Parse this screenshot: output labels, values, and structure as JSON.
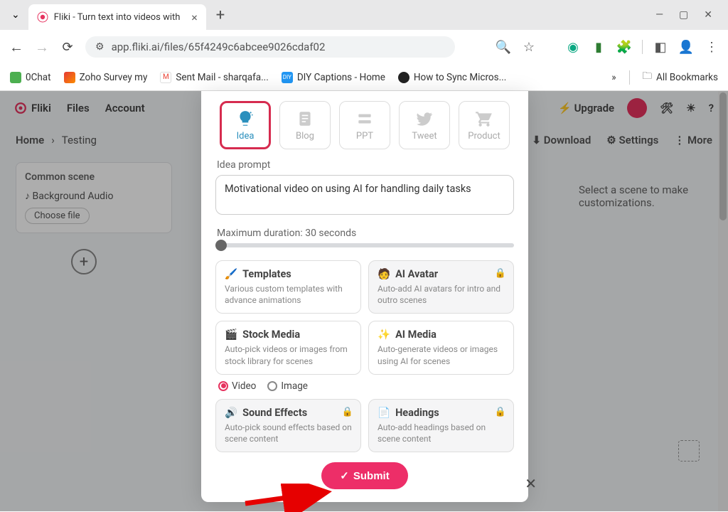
{
  "browser": {
    "tab_title": "Fliki - Turn text into videos with",
    "url": "app.fliki.ai/files/65f4249c6abcee9026cdaf02",
    "bookmarks": [
      {
        "label": "0Chat",
        "color": "#4caf50"
      },
      {
        "label": "Zoho Survey my",
        "color": "#d94b3c"
      },
      {
        "label": "Sent Mail - sharqafa...",
        "color": "#ea4335"
      },
      {
        "label": "DIY Captions - Home",
        "color": "#2196f3"
      },
      {
        "label": "How to Sync Micros...",
        "color": "#222"
      }
    ],
    "all_bookmarks": "All Bookmarks"
  },
  "app": {
    "brand": "Fliki",
    "nav": {
      "files": "Files",
      "account": "Account"
    },
    "header_right": {
      "upgrade": "Upgrade"
    },
    "breadcrumbs": {
      "home": "Home",
      "sep": "›",
      "current": "Testing"
    },
    "toolbar": {
      "download": "Download",
      "settings": "Settings",
      "more": "More"
    },
    "left_panel": {
      "title": "Common scene",
      "audio": "Background Audio",
      "choose_file": "Choose file"
    },
    "right_panel": {
      "placeholder": "Select a scene to make customizations."
    }
  },
  "modal": {
    "tabs": [
      {
        "key": "idea",
        "label": "Idea",
        "active": true
      },
      {
        "key": "blog",
        "label": "Blog"
      },
      {
        "key": "ppt",
        "label": "PPT"
      },
      {
        "key": "tweet",
        "label": "Tweet"
      },
      {
        "key": "product",
        "label": "Product"
      }
    ],
    "prompt_label": "Idea prompt",
    "prompt_value": "Motivational video on using AI for handling daily tasks",
    "duration_label": "Maximum duration: 30 seconds",
    "cards": [
      {
        "title": "Templates",
        "desc": "Various custom templates with advance animations",
        "icon": "🖌️",
        "locked": false
      },
      {
        "title": "AI Avatar",
        "desc": "Auto-add AI avatars for intro and outro scenes",
        "icon": "🧑",
        "locked": true
      },
      {
        "title": "Stock Media",
        "desc": "Auto-pick videos or images from stock library for scenes",
        "icon": "🎬",
        "locked": false
      },
      {
        "title": "AI Media",
        "desc": "Auto-generate videos or images using AI for scenes",
        "icon": "✨",
        "locked": false
      },
      {
        "title": "Sound Effects",
        "desc": "Auto-pick sound effects based on scene content",
        "icon": "🔊",
        "locked": true
      },
      {
        "title": "Headings",
        "desc": "Auto-add headings based on scene content",
        "icon": "📄",
        "locked": true
      }
    ],
    "media_radios": {
      "video": "Video",
      "image": "Image",
      "selected": "video"
    },
    "submit": "Submit"
  }
}
